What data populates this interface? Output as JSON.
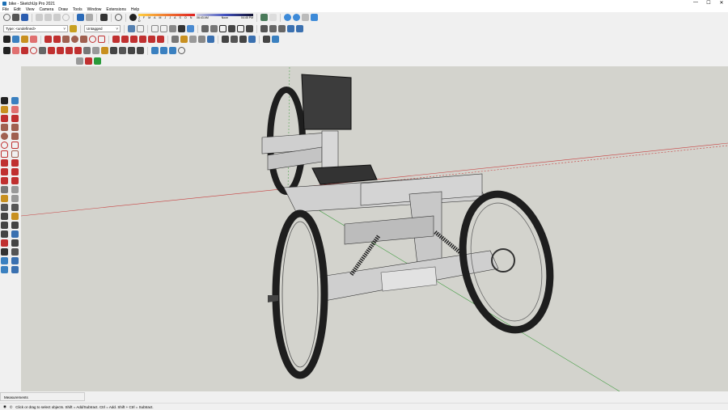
{
  "window": {
    "title": "bike - SketchUp Pro 2021",
    "controls": [
      "—",
      "☐",
      "✕"
    ]
  },
  "menu": [
    "File",
    "Edit",
    "View",
    "Camera",
    "Draw",
    "Tools",
    "Window",
    "Extensions",
    "Help"
  ],
  "toolbar": {
    "type_combo": "Type: <undefined>",
    "tag_combo": "Untagged",
    "shadow_months": "J F M A M J J A S O N D",
    "time_start": "06:43 AM",
    "time_mid": "Noon",
    "time_end": "04:45 PM"
  },
  "colors": {
    "viewport_bg": "#d3d3cd",
    "axis_red": "#c84040",
    "axis_green": "#3a9a3a",
    "wheel": "#1e1e1e",
    "frame": "#cfcfcf",
    "seat": "#3a3a3a"
  },
  "measurements_label": "Measurements",
  "status_text": "Click or drag to select objects. Shift = Add/Subtract. Ctrl = Add. Shift + Ctrl = Subtract."
}
